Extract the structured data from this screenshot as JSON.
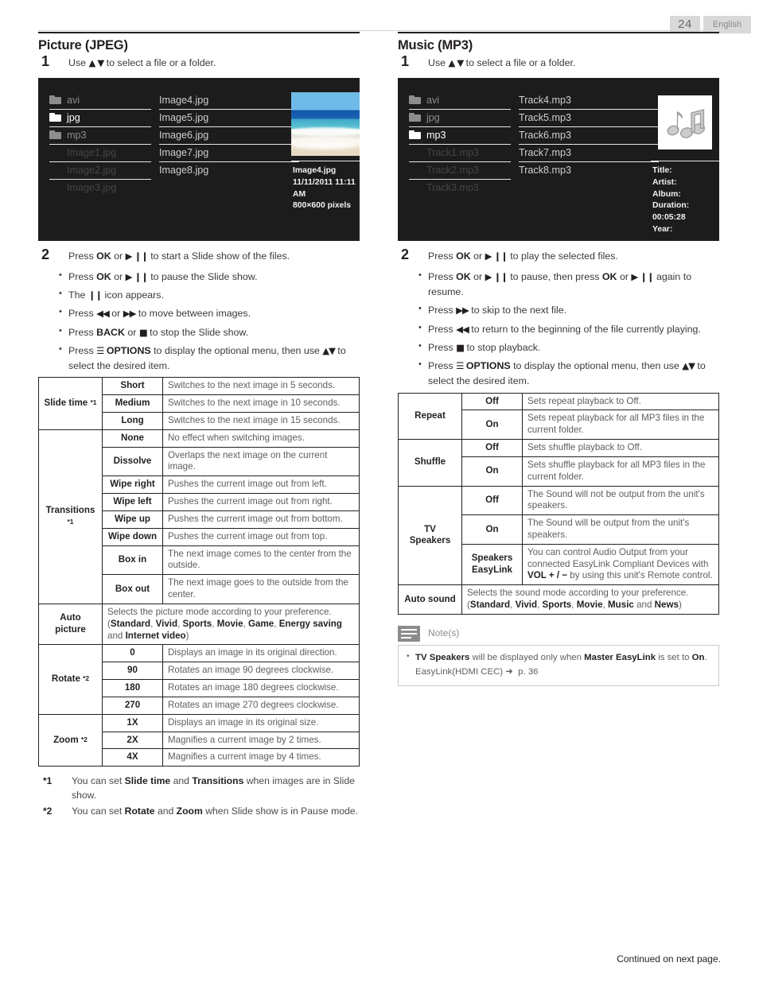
{
  "header": {
    "page_number": "24",
    "language": "English"
  },
  "footer": {
    "continued": "Continued on next page."
  },
  "left": {
    "title": "Picture (JPEG)",
    "step1_num": "1",
    "step1_text_a": "Use ",
    "step1_glyphs": "▲ ▼",
    "step1_text_b": " to select a file or a folder.",
    "screen": {
      "col_a": [
        {
          "label": "avi",
          "type": "folder",
          "state": "dim",
          "underline": true
        },
        {
          "label": "jpg",
          "type": "folder",
          "state": "bright",
          "underline": true
        },
        {
          "label": "mp3",
          "type": "folder",
          "state": "dim",
          "underline": true
        },
        {
          "label": "Image1.jpg",
          "type": "file",
          "state": "faint",
          "underline": true
        },
        {
          "label": "Image2.jpg",
          "type": "file",
          "state": "faint",
          "underline": true
        },
        {
          "label": "Image3.jpg",
          "type": "file",
          "state": "faint",
          "underline": false
        }
      ],
      "col_b": [
        {
          "label": "Image4.jpg",
          "underline": true
        },
        {
          "label": "Image5.jpg",
          "underline": true
        },
        {
          "label": "Image6.jpg",
          "underline": true
        },
        {
          "label": "Image7.jpg",
          "underline": true
        },
        {
          "label": "Image8.jpg",
          "underline": false
        }
      ],
      "meta": [
        "Image4.jpg",
        "11/11/2011 11:11 AM",
        "800×600 pixels"
      ]
    },
    "step2_num": "2",
    "step2_pre": "Press ",
    "step2_ok": "OK",
    "step2_or": " or ",
    "step2_glyph": "▶ ❙❙",
    "step2_post": " to start a Slide show of the files.",
    "bullets": [
      {
        "html": "Press <span class='b'>OK</span> or <span class='gl b'>▶ ❙❙</span> to pause the Slide show."
      },
      {
        "html": "The <span class='gl b'>❙❙</span> icon appears."
      },
      {
        "html": "Press <span class='gl b'>◀◀</span> or <span class='gl b'>▶▶</span> to move between images."
      },
      {
        "html": "Press <span class='b'>BACK</span> or <span class='gl b'>■</span> to stop the Slide show."
      },
      {
        "html": "Press <span class='gl b'>☰</span> <span class='b'>OPTIONS</span> to display the optional menu, then use <span class='gl b'>▲▼</span> to select the desired item."
      }
    ],
    "table": [
      {
        "name": "Slide time",
        "sup": "*1",
        "rowspan": 3,
        "rows": [
          {
            "value": "Short",
            "desc": "Switches to the next image in 5 seconds."
          },
          {
            "value": "Medium",
            "desc": "Switches to the next image in 10 seconds."
          },
          {
            "value": "Long",
            "desc": "Switches to the next image in 15 seconds."
          }
        ]
      },
      {
        "name": "Transitions",
        "sup": "*1",
        "rowspan": 8,
        "rows": [
          {
            "value": "None",
            "desc": "No effect when switching images."
          },
          {
            "value": "Dissolve",
            "desc": "Overlaps the next image on the current image."
          },
          {
            "value": "Wipe right",
            "desc": "Pushes the current image out from left."
          },
          {
            "value": "Wipe left",
            "desc": "Pushes the current image out from right."
          },
          {
            "value": "Wipe up",
            "desc": "Pushes the current image out from bottom."
          },
          {
            "value": "Wipe down",
            "desc": "Pushes the current image out from top."
          },
          {
            "value": "Box in",
            "desc": "The next image comes to the center from the outside."
          },
          {
            "value": "Box out",
            "desc": "The next image goes to the outside from the center."
          }
        ]
      },
      {
        "name": "Auto picture",
        "sup": "",
        "rowspan": 1,
        "wide": true,
        "wide_html": "Selects the picture mode according to your preference. (<span class='b'>Standard</span>, <span class='b'>Vivid</span>, <span class='b'>Sports</span>, <span class='b'>Movie</span>, <span class='b'>Game</span>, <span class='b'>Energy saving</span> and <span class='b'>Internet video</span>)"
      },
      {
        "name": "Rotate",
        "sup": "*2",
        "rowspan": 4,
        "rows": [
          {
            "value": "0",
            "desc": "Displays an image in its original direction."
          },
          {
            "value": "90",
            "desc": "Rotates an image 90 degrees clockwise."
          },
          {
            "value": "180",
            "desc": "Rotates an image 180 degrees clockwise."
          },
          {
            "value": "270",
            "desc": "Rotates an image 270 degrees clockwise."
          }
        ]
      },
      {
        "name": "Zoom",
        "sup": "*2",
        "rowspan": 3,
        "rows": [
          {
            "value": "1X",
            "desc": "Displays an image in its original size."
          },
          {
            "value": "2X",
            "desc": "Magnifies a current image by 2 times."
          },
          {
            "value": "4X",
            "desc": "Magnifies a current image by 4 times."
          }
        ]
      }
    ],
    "footnotes": [
      {
        "mark": "*1",
        "html": "You can set <span class='b'>Slide time</span> and <span class='b'>Transitions</span> when images are in Slide show."
      },
      {
        "mark": "*2",
        "html": "You can set <span class='b'>Rotate</span> and <span class='b'>Zoom</span> when Slide show is in Pause mode."
      }
    ]
  },
  "right": {
    "title": "Music (MP3)",
    "step1_num": "1",
    "step1_text_a": "Use ",
    "step1_glyphs": "▲ ▼",
    "step1_text_b": " to select a file or a folder.",
    "screen": {
      "col_a": [
        {
          "label": "avi",
          "type": "folder",
          "state": "dim",
          "underline": true
        },
        {
          "label": "jpg",
          "type": "folder",
          "state": "dim",
          "underline": true
        },
        {
          "label": "mp3",
          "type": "folder",
          "state": "bright",
          "underline": true
        },
        {
          "label": "Track1.mp3",
          "type": "file",
          "state": "faint",
          "underline": true
        },
        {
          "label": "Track2.mp3",
          "type": "file",
          "state": "faint",
          "underline": true
        },
        {
          "label": "Track3.mp3",
          "type": "file",
          "state": "faint",
          "underline": false
        }
      ],
      "col_b": [
        {
          "label": "Track4.mp3",
          "underline": true
        },
        {
          "label": "Track5.mp3",
          "underline": true
        },
        {
          "label": "Track6.mp3",
          "underline": true
        },
        {
          "label": "Track7.mp3",
          "underline": true
        },
        {
          "label": "Track8.mp3",
          "underline": false
        }
      ],
      "meta": [
        "Title:",
        "Artist:",
        "Album:",
        "Duration: 00:05:28",
        "Year:"
      ]
    },
    "step2_num": "2",
    "step2_pre": "Press ",
    "step2_ok": "OK",
    "step2_or": " or ",
    "step2_glyph": "▶ ❙❙",
    "step2_post": " to play the selected files.",
    "bullets": [
      {
        "html": "Press <span class='b'>OK</span> or <span class='gl b'>▶ ❙❙</span> to pause, then press <span class='b'>OK</span> or <span class='gl b'>▶ ❙❙</span> again to resume."
      },
      {
        "html": "Press <span class='gl b'>▶▶</span> to skip to the next file."
      },
      {
        "html": "Press <span class='gl b'>◀◀</span> to return to the beginning of the file currently playing."
      },
      {
        "html": "Press <span class='gl b'>■</span> to stop playback."
      },
      {
        "html": "Press <span class='gl b'>☰</span> <span class='b'>OPTIONS</span> to display the optional menu, then use <span class='gl b'>▲▼</span> to select the desired item."
      }
    ],
    "table": [
      {
        "name": "Repeat",
        "sup": "",
        "rowspan": 2,
        "rows": [
          {
            "value": "Off",
            "desc": "Sets repeat playback to Off."
          },
          {
            "value": "On",
            "desc": "Sets repeat playback for all MP3 files in the current folder."
          }
        ]
      },
      {
        "name": "Shuffle",
        "sup": "",
        "rowspan": 2,
        "rows": [
          {
            "value": "Off",
            "desc": "Sets shuffle playback to Off."
          },
          {
            "value": "On",
            "desc": "Sets shuffle playback for all MP3 files in the current folder."
          }
        ]
      },
      {
        "name": "TV Speakers",
        "sup": "",
        "rowspan": 3,
        "rows": [
          {
            "value": "Off",
            "desc": "The Sound will not be output from the unit's speakers."
          },
          {
            "value": "On",
            "desc": "The Sound will be output from the unit's speakers."
          },
          {
            "value": "Speakers EasyLink",
            "desc_html": "You can control Audio Output from your connected EasyLink Compliant Devices with <span class='b'>VOL + / −</span> by using this unit's Remote control."
          }
        ]
      },
      {
        "name": "Auto sound",
        "sup": "",
        "rowspan": 1,
        "wide": true,
        "wide_html": "Selects the sound mode according to your preference. (<span class='b'>Standard</span>, <span class='b'>Vivid</span>, <span class='b'>Sports</span>, <span class='b'>Movie</span>, <span class='b'>Music</span> and <span class='b'>News</span>)"
      }
    ],
    "note": {
      "title": "Note(s)",
      "items": [
        {
          "html": "<span class='b'>TV Speakers</span> will be displayed only when <span class='b'>Master EasyLink</span> is set to <span class='b'>On</span>.<br>EasyLink(HDMI CEC) <span class='arrow'>➜</span>&nbsp; p. 36"
        }
      ]
    }
  }
}
